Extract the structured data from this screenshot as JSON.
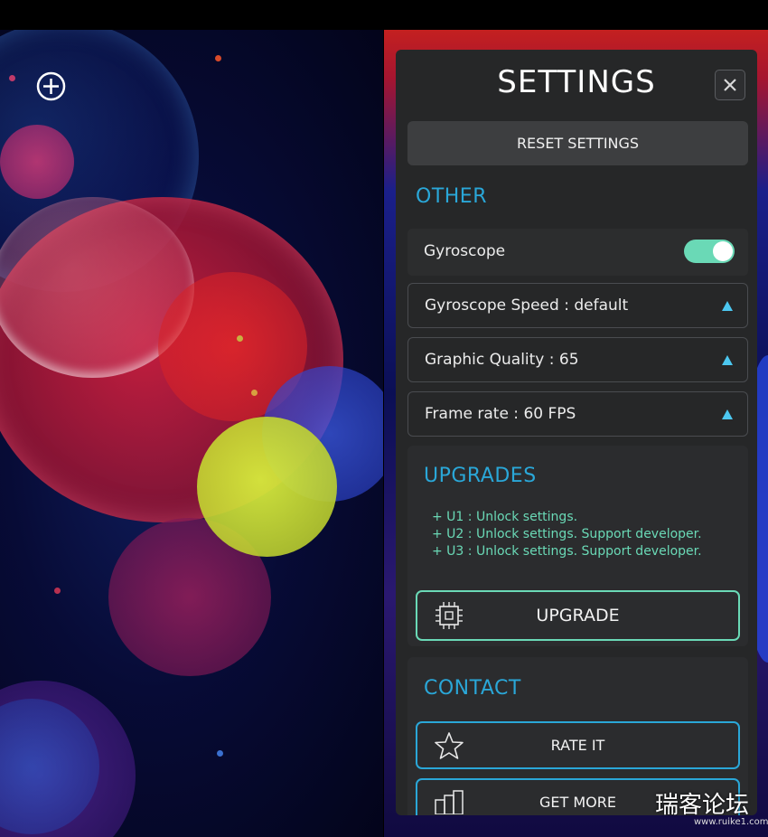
{
  "settings": {
    "title": "SETTINGS",
    "reset_label": "RESET SETTINGS",
    "sections": {
      "other": "OTHER",
      "upgrades": "UPGRADES",
      "contact": "CONTACT"
    },
    "gyroscope": {
      "label": "Gyroscope",
      "enabled": true
    },
    "selects": [
      {
        "label": "Gyroscope Speed : default"
      },
      {
        "label": "Graphic Quality : 65"
      },
      {
        "label": "Frame rate : 60 FPS"
      }
    ],
    "upgrade_lines": [
      "+ U1 : Unlock settings.",
      "+ U2 : Unlock settings. Support developer.",
      "+ U3 : Unlock settings. Support developer."
    ],
    "upgrade_button": "UPGRADE",
    "rate_button": "RATE IT",
    "more_button": "GET MORE"
  },
  "watermark": {
    "text": "瑞客论坛",
    "url": "www.ruike1.com"
  },
  "icons": {
    "add": "plus-circle-icon",
    "close": "close-icon",
    "chip": "chip-icon",
    "star": "star-icon",
    "apps": "apps-stack-icon",
    "arrow": "triangle-up-icon"
  },
  "colors": {
    "accent_blue": "#2aa7d8",
    "accent_green": "#6ad9b6",
    "panel_bg": "#262728"
  }
}
